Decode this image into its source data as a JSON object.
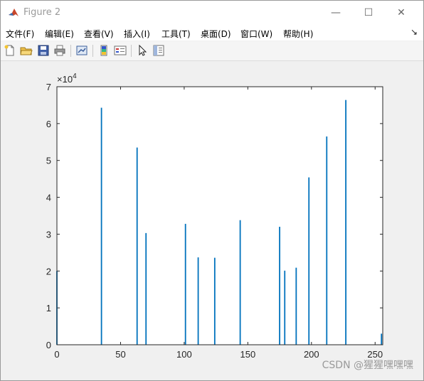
{
  "window": {
    "title": "Figure 2",
    "controls": {
      "minimize": "—",
      "maximize": "☐",
      "close": "✕"
    }
  },
  "menubar": {
    "items": [
      {
        "label": "文件(F)"
      },
      {
        "label": "编辑(E)"
      },
      {
        "label": "查看(V)"
      },
      {
        "label": "插入(I)"
      },
      {
        "label": "工具(T)"
      },
      {
        "label": "桌面(D)"
      },
      {
        "label": "窗口(W)"
      },
      {
        "label": "帮助(H)"
      }
    ],
    "overflow_icon": "↘"
  },
  "toolbar": {
    "buttons": [
      {
        "icon": "new-figure-icon"
      },
      {
        "icon": "open-file-icon"
      },
      {
        "icon": "save-icon"
      },
      {
        "icon": "print-icon"
      },
      {
        "icon": "link-plot-icon"
      },
      {
        "icon": "colorbar-icon"
      },
      {
        "icon": "legend-icon"
      },
      {
        "icon": "edit-plot-arrow-icon"
      },
      {
        "icon": "property-inspector-icon"
      }
    ]
  },
  "chart_data": {
    "type": "bar",
    "title": "",
    "xlabel": "",
    "ylabel": "",
    "exponent_label": "×10",
    "exponent_power": "4",
    "xlim": [
      0,
      256
    ],
    "ylim": [
      0,
      7
    ],
    "xticks": [
      0,
      50,
      100,
      150,
      200,
      250
    ],
    "yticks": [
      0,
      1,
      2,
      3,
      4,
      5,
      6,
      7
    ],
    "series_color": "#0072bd",
    "x": [
      0,
      35,
      63,
      70,
      101,
      111,
      124,
      144,
      175,
      179,
      188,
      198,
      212,
      227,
      255
    ],
    "values": [
      2.0,
      6.43,
      5.35,
      3.03,
      3.28,
      2.37,
      2.36,
      3.38,
      3.2,
      2.01,
      2.09,
      4.54,
      5.65,
      6.64,
      0.3
    ]
  },
  "watermark": "CSDN @猩猩嘿嘿嘿"
}
